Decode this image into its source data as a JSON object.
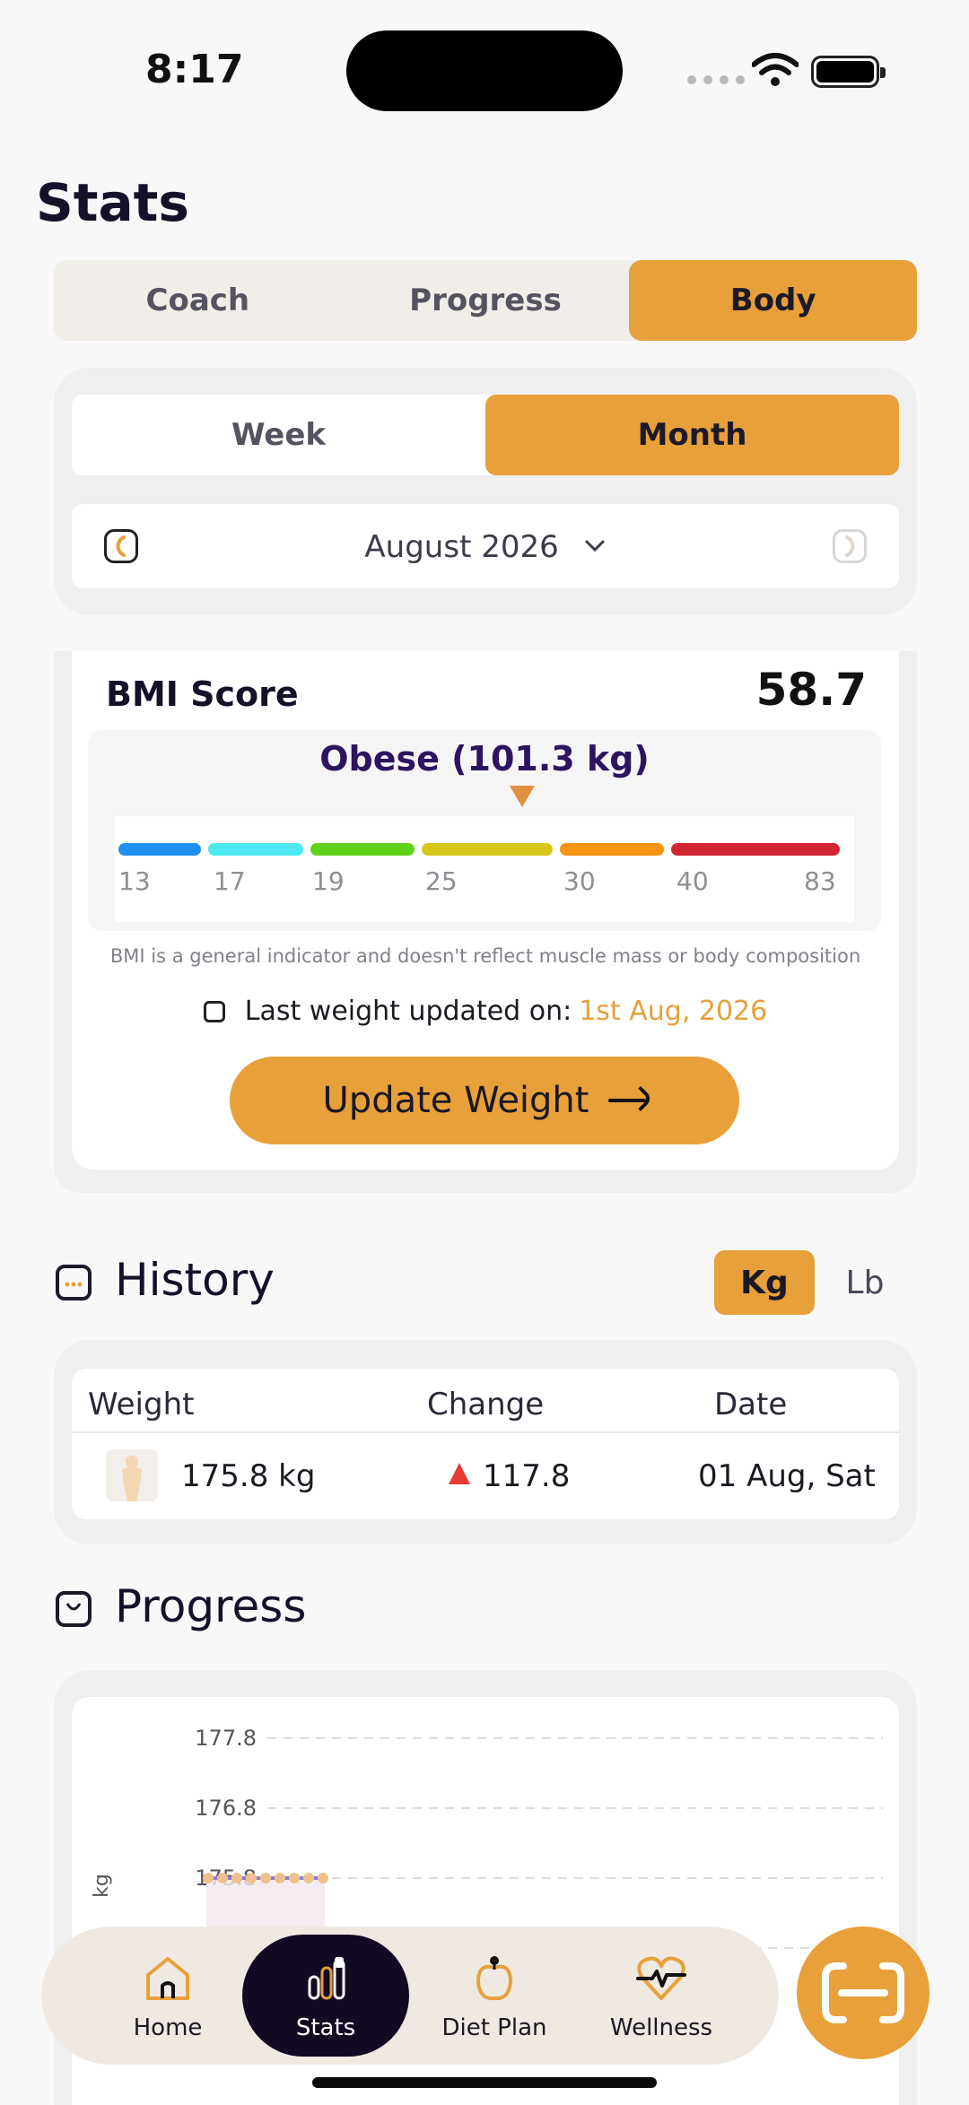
{
  "status": {
    "time": "8:17"
  },
  "page": {
    "title": "Stats"
  },
  "main_tabs": [
    {
      "label": "Coach",
      "active": false
    },
    {
      "label": "Progress",
      "active": false
    },
    {
      "label": "Body",
      "active": true
    }
  ],
  "period_tabs": [
    {
      "label": "Week",
      "active": false
    },
    {
      "label": "Month",
      "active": true
    }
  ],
  "month_selector": {
    "label": "August 2026"
  },
  "bmi": {
    "title": "BMI Score",
    "score": "58.7",
    "category": "Obese (101.3 kg)",
    "ticks": [
      "13",
      "17",
      "19",
      "25",
      "30",
      "40",
      "83"
    ],
    "segment_colors": [
      "#1f8ff0",
      "#4ee8f0",
      "#5fd21c",
      "#d7c71a",
      "#f79312",
      "#d12632"
    ],
    "note": "BMI is a general indicator and doesn't reflect muscle mass or body composition",
    "last_updated_label": "Last weight updated on:",
    "last_updated_value": "1st Aug, 2026",
    "update_button": "Update Weight"
  },
  "history": {
    "title": "History",
    "units": [
      {
        "label": "Kg",
        "active": true
      },
      {
        "label": "Lb",
        "active": false
      }
    ],
    "columns": [
      "Weight",
      "Change",
      "Date"
    ],
    "rows": [
      {
        "weight": "175.8 kg",
        "change": "117.8",
        "date": "01 Aug, Sat"
      }
    ]
  },
  "progress": {
    "title": "Progress"
  },
  "chart_data": {
    "type": "line",
    "ylabel": "kg",
    "y_ticks": [
      "177.8",
      "176.8",
      "175.8"
    ],
    "series": [
      {
        "values": [
          175.8,
          175.8,
          175.8,
          175.8,
          175.8,
          175.8,
          175.8,
          175.8,
          175.8
        ]
      }
    ],
    "colors": {
      "line": "#8a7fd0",
      "marker": "#f0c08c"
    }
  },
  "nav": [
    {
      "label": "Home",
      "active": false,
      "icon": "home-icon"
    },
    {
      "label": "Stats",
      "active": true,
      "icon": "stats-icon"
    },
    {
      "label": "Diet Plan",
      "active": false,
      "icon": "apple-icon"
    },
    {
      "label": "Wellness",
      "active": false,
      "icon": "heart-pulse-icon"
    }
  ],
  "colors": {
    "accent": "#e8a03a",
    "dark": "#120a22"
  }
}
